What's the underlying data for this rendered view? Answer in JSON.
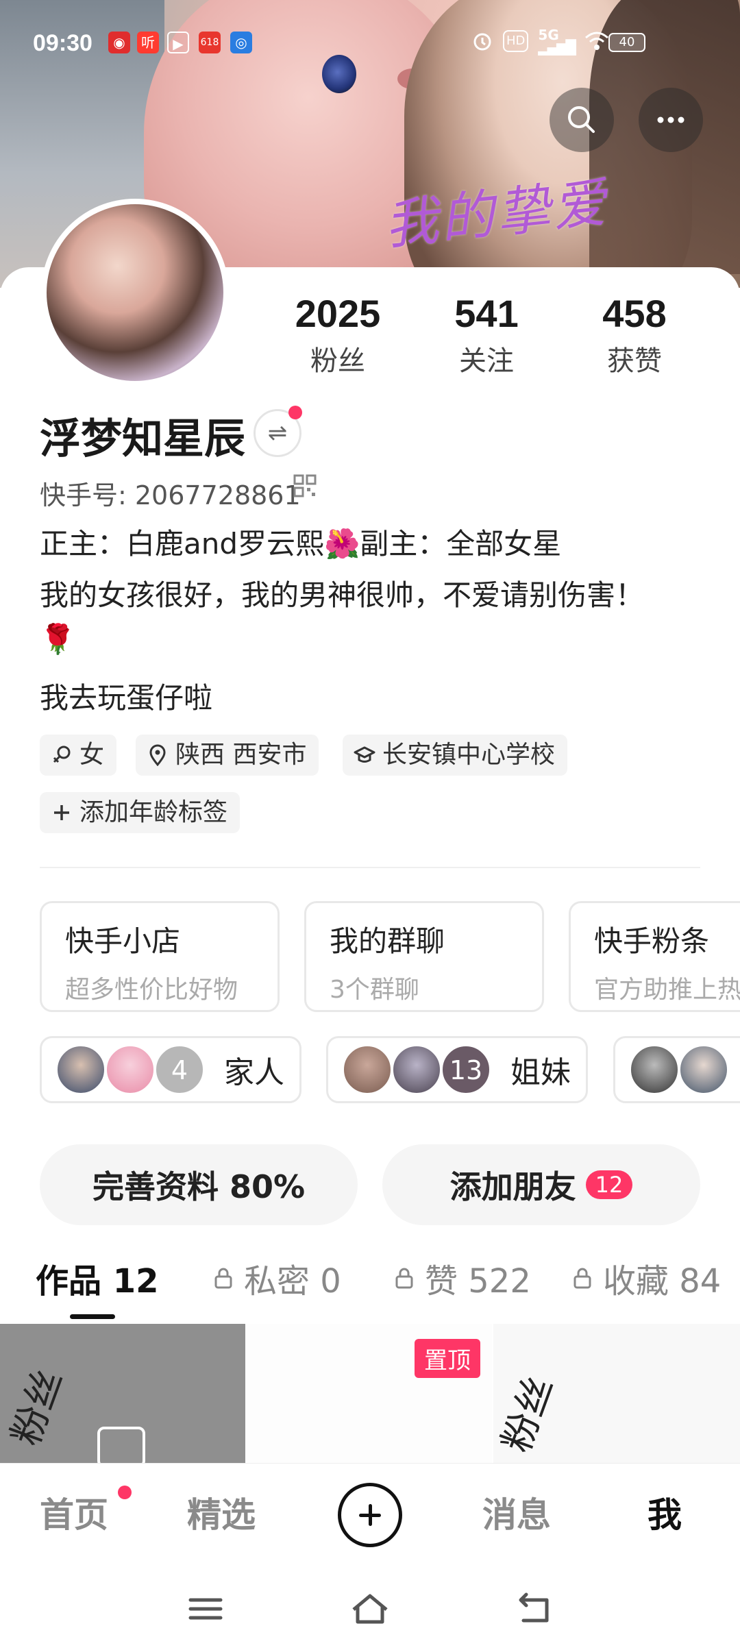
{
  "status_bar": {
    "time": "09:30",
    "app_badge": "618",
    "hd_label": "HD",
    "network": "5G",
    "battery": "40"
  },
  "cover": {
    "overlay_text": "我的挚爱"
  },
  "profile": {
    "stats": [
      {
        "value": "2025",
        "label": "粉丝"
      },
      {
        "value": "541",
        "label": "关注"
      },
      {
        "value": "458",
        "label": "获赞"
      }
    ],
    "nickname": "浮梦知星辰",
    "kuaishou_id": "快手号: 2067728861",
    "bio_lines": [
      "正主：白鹿and罗云熙🌺副主：全部女星",
      "我的女孩很好，我的男神很帅，不爱请别伤害！",
      "🌹",
      "我去玩蛋仔啦"
    ],
    "tags": [
      {
        "label": "女",
        "icon": "female-icon"
      },
      {
        "label": "陕西 西安市",
        "icon": "location-icon"
      },
      {
        "label": "长安镇中心学校",
        "icon": "school-icon"
      },
      {
        "label": "添加年龄标签",
        "icon": "plus-icon"
      }
    ]
  },
  "features": [
    {
      "title": "快手小店",
      "subtitle": "超多性价比好物"
    },
    {
      "title": "我的群聊",
      "subtitle": "3个群聊"
    },
    {
      "title": "快手粉条",
      "subtitle": "官方助推上热"
    }
  ],
  "groups": [
    {
      "name": "家人",
      "count": "4"
    },
    {
      "name": "姐妹",
      "count": "13"
    }
  ],
  "actions": {
    "complete_profile": "完善资料 80%",
    "add_friend": "添加朋友",
    "add_friend_badge": "12"
  },
  "tabs": [
    {
      "label": "作品 12",
      "locked": false
    },
    {
      "label": "私密 0",
      "locked": true
    },
    {
      "label": "赞 522",
      "locked": true
    },
    {
      "label": "收藏 84",
      "locked": true
    }
  ],
  "grid": {
    "pinned_label": "置顶",
    "cell_text": "粉丝"
  },
  "bottom_nav": {
    "home": "首页",
    "featured": "精选",
    "messages": "消息",
    "me": "我"
  },
  "colors": {
    "accent": "#fe3666",
    "cover_text": "#b15ad6"
  }
}
